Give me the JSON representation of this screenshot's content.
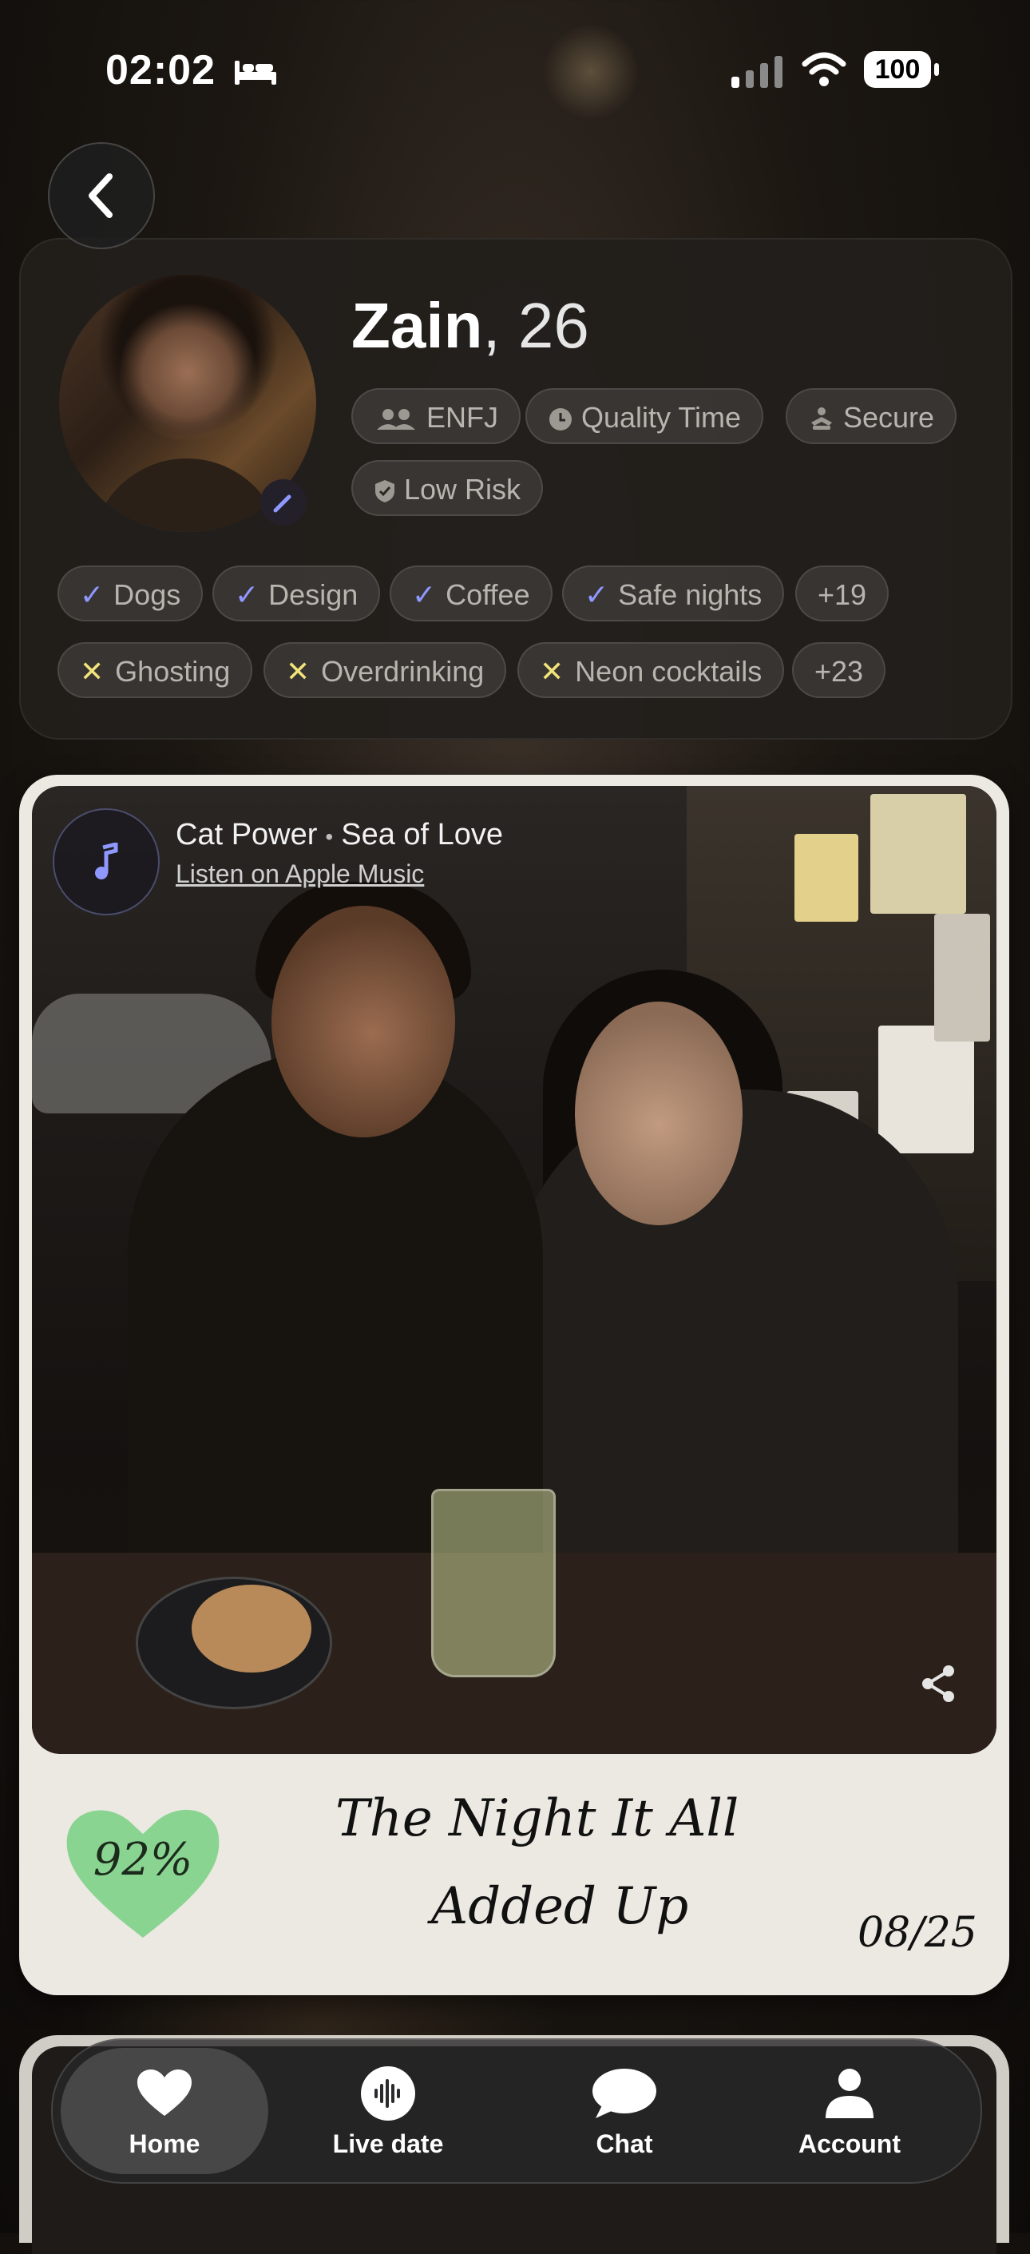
{
  "status_bar": {
    "time": "02:02",
    "battery": "100"
  },
  "profile": {
    "name": "Zain",
    "separator": ",",
    "age": "26",
    "traits": [
      "ENFJ",
      "Quality Time",
      "Secure",
      "Low Risk"
    ],
    "likes": [
      "Dogs",
      "Design",
      "Coffee",
      "Safe nights"
    ],
    "likes_more": "+19",
    "dislikes": [
      "Ghosting",
      "Overdrinking",
      "Neon cocktails"
    ],
    "dislikes_more": "+23"
  },
  "post": {
    "artist": "Cat Power",
    "song": "Sea of Love",
    "listen_link": "Listen on Apple Music",
    "match_score": "92%",
    "caption_line1": "The Night It All",
    "caption_line2": "Added Up",
    "date": "08/25"
  },
  "nav": {
    "items": [
      {
        "label": "Home",
        "icon": "heart-icon",
        "active": true
      },
      {
        "label": "Live date",
        "icon": "waveform-icon"
      },
      {
        "label": "Chat",
        "icon": "chat-bubble-icon"
      },
      {
        "label": "Account",
        "icon": "person-icon"
      }
    ]
  },
  "colors": {
    "accent_check": "#8f98ff",
    "accent_x": "#f2e37a",
    "heart_green": "#7fd18a",
    "card_paper": "#ece9e2"
  }
}
